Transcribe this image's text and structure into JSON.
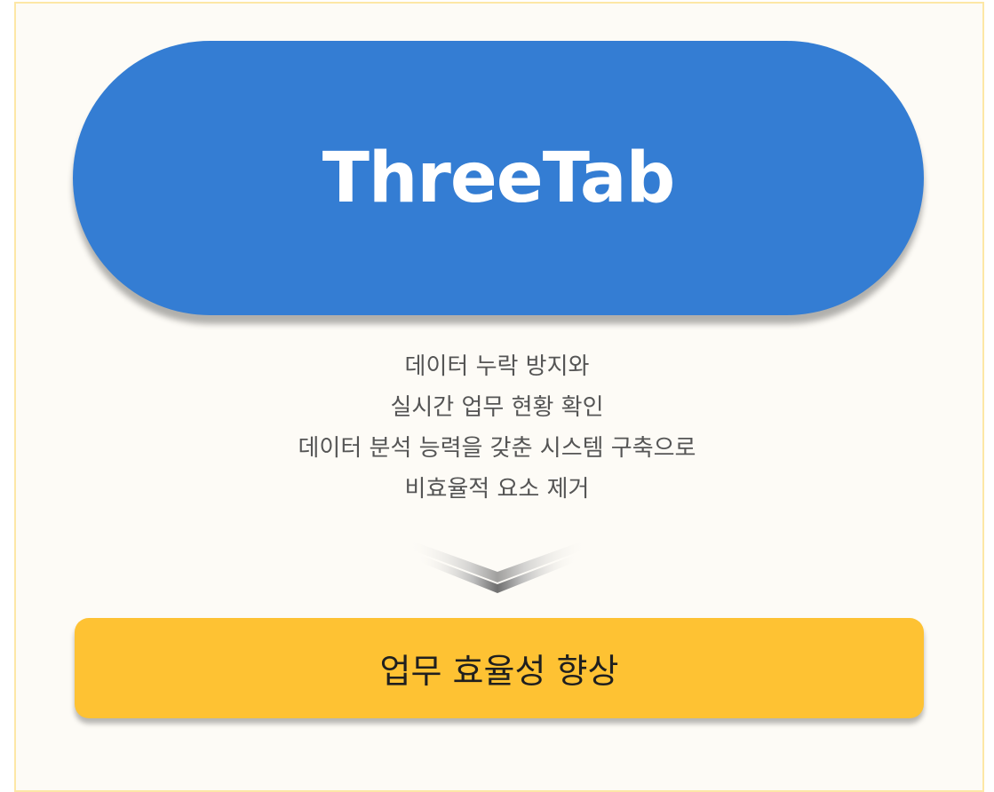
{
  "title": "ThreeTab",
  "description_lines": [
    "데이터 누락 방지와",
    "실시간 업무 현황 확인",
    "데이터 분석 능력을 갖춘 시스템 구축으로",
    "비효율적 요소 제거"
  ],
  "arrow_icon": "chevron-down-icon",
  "result": "업무 효율성 향상",
  "colors": {
    "pill": "#347dd3",
    "result_box": "#fec233",
    "background": "#fdfbf6",
    "frame_border": "#fde7a6"
  }
}
